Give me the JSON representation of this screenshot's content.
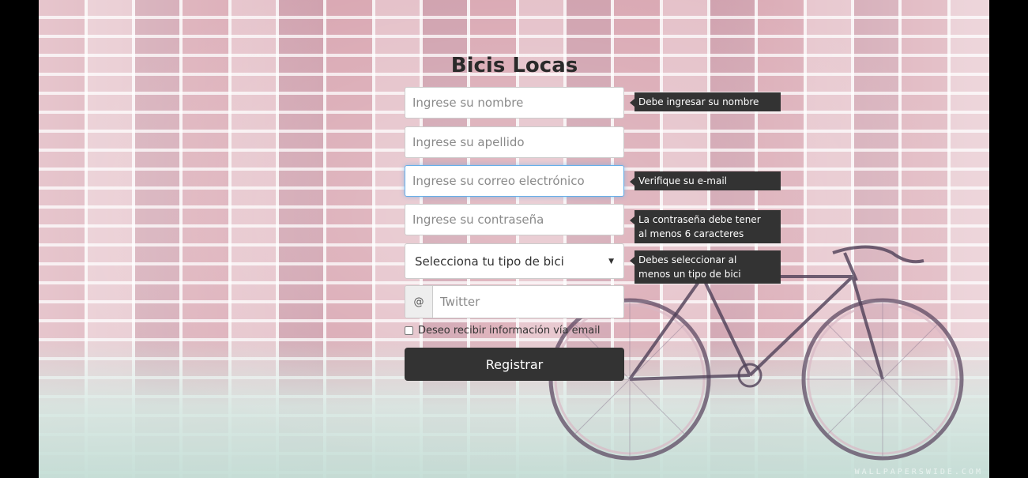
{
  "page": {
    "title": "Bicis Locas"
  },
  "form": {
    "name_placeholder": "Ingrese su nombre",
    "lastname_placeholder": "Ingrese su apellido",
    "email_placeholder": "Ingrese su correo electrónico",
    "password_placeholder": "Ingrese su contraseña",
    "bike_select_value": "Selecciona tu tipo de bici",
    "twitter_addon": "@",
    "twitter_placeholder": "Twitter",
    "newsletter_label": "Deseo recibir información vía email",
    "submit_label": "Registrar"
  },
  "errors": {
    "name": "Debe ingresar su nombre",
    "email": "Verifique su e-mail",
    "password_line1": "La contraseña debe tener",
    "password_line2": "al menos 6 caracteres",
    "bike_line1": "Debes seleccionar al",
    "bike_line2": "menos un tipo de bici"
  },
  "background": {
    "watermark": "WALLPAPERSWIDE.COM"
  }
}
